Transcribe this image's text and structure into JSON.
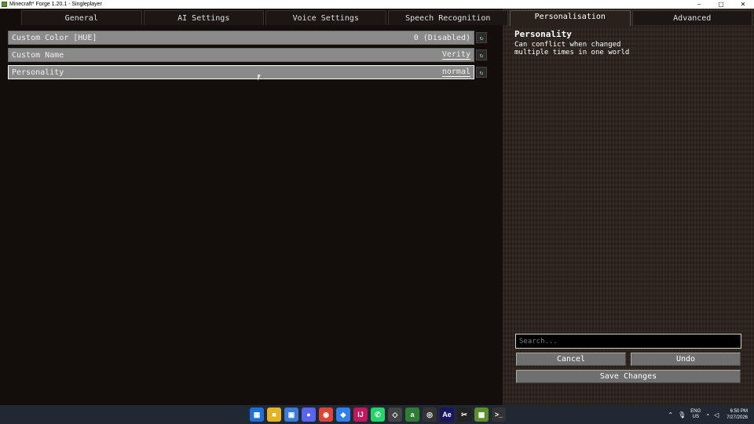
{
  "window": {
    "title": "Minecraft* Forge 1.20.1 - Singleplayer",
    "controls": [
      "–",
      "▢",
      "✕"
    ]
  },
  "tabs": [
    {
      "label": "General"
    },
    {
      "label": "AI Settings"
    },
    {
      "label": "Voice Settings"
    },
    {
      "label": "Speech Recognition"
    },
    {
      "label": "Personalisation",
      "active": true
    },
    {
      "label": "Advanced"
    }
  ],
  "config_rows": [
    {
      "label": "Custom Color [HUE]",
      "value": "0 (Disabled)"
    },
    {
      "label": "Custom Name",
      "value": "Verity"
    },
    {
      "label": "Personality",
      "value": "normal",
      "selected": true
    }
  ],
  "reset_glyph": "↻",
  "info": {
    "title": "Personality",
    "description": "Can conflict when changed multiple times in one world"
  },
  "search": {
    "placeholder": "Search..."
  },
  "buttons": {
    "cancel": "Cancel",
    "undo": "Undo",
    "save": "Save Changes"
  },
  "taskbar": {
    "apps": [
      {
        "name": "windows-start-icon",
        "color": "#1e6fd9",
        "glyph": "▦"
      },
      {
        "name": "file-explorer-icon",
        "color": "#e6b422",
        "glyph": "■"
      },
      {
        "name": "store-icon",
        "color": "#3a7bd5",
        "glyph": "▣"
      },
      {
        "name": "discord-icon",
        "color": "#5865f2",
        "glyph": "●"
      },
      {
        "name": "chrome-icon",
        "color": "#db4437",
        "glyph": "◉"
      },
      {
        "name": "photos-icon",
        "color": "#2f80ed",
        "glyph": "◆"
      },
      {
        "name": "intellij-icon",
        "color": "#c2185b",
        "glyph": "IJ"
      },
      {
        "name": "whatsapp-icon",
        "color": "#25d366",
        "glyph": "✆"
      },
      {
        "name": "unity-icon",
        "color": "#444444",
        "glyph": "◇"
      },
      {
        "name": "atlauncher-icon",
        "color": "#2e7d32",
        "glyph": "a"
      },
      {
        "name": "obs-icon",
        "color": "#333333",
        "glyph": "◎"
      },
      {
        "name": "after-effects-icon",
        "color": "#1b1464",
        "glyph": "Ae"
      },
      {
        "name": "capcut-icon",
        "color": "#222222",
        "glyph": "✂"
      },
      {
        "name": "minecraft-icon",
        "color": "#5a8f2c",
        "glyph": "▩"
      },
      {
        "name": "terminal-icon",
        "color": "#333333",
        "glyph": ">_"
      }
    ],
    "tray": {
      "language": "ENG",
      "region": "US",
      "time": "6:50 PM",
      "date": "7/27/2026"
    }
  }
}
